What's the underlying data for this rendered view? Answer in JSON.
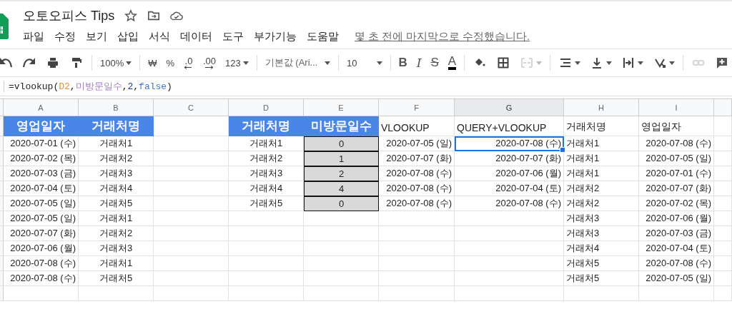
{
  "document": {
    "title": "오토오피스 Tips",
    "starred": false
  },
  "menu": [
    "파일",
    "수정",
    "보기",
    "삽입",
    "서식",
    "데이터",
    "도구",
    "부가기능",
    "도움말"
  ],
  "last_edit": "몇 초 전에 마지막으로 수정했습니다.",
  "toolbar": [
    {
      "kind": "undo",
      "disabled": false,
      "dropdown": false
    },
    {
      "kind": "redo",
      "disabled": false,
      "dropdown": false
    },
    {
      "kind": "print",
      "disabled": false,
      "dropdown": false
    },
    {
      "kind": "paint-format",
      "disabled": false,
      "dropdown": false
    },
    {
      "kind": "separator"
    },
    {
      "kind": "text",
      "text": "100%",
      "disabled": false,
      "dropdown": true
    },
    {
      "kind": "separator"
    },
    {
      "kind": "text",
      "text": "₩",
      "disabled": false,
      "dropdown": false
    },
    {
      "kind": "text",
      "text": "%",
      "disabled": false,
      "dropdown": false
    },
    {
      "kind": "decimal-decrease",
      "text": ".0",
      "disabled": false,
      "dropdown": false
    },
    {
      "kind": "decimal-increase",
      "text": ".00",
      "disabled": false,
      "dropdown": false
    },
    {
      "kind": "text",
      "text": "123",
      "disabled": false,
      "dropdown": true
    },
    {
      "kind": "separator"
    },
    {
      "kind": "font",
      "text": "기본값 (Ari...",
      "disabled": false,
      "dropdown": true
    },
    {
      "kind": "separator"
    },
    {
      "kind": "font-size",
      "text": "10",
      "disabled": false,
      "dropdown": true
    },
    {
      "kind": "separator"
    },
    {
      "kind": "bold",
      "text": "B",
      "disabled": false,
      "dropdown": false
    },
    {
      "kind": "italic",
      "text": "I",
      "disabled": false,
      "dropdown": false
    },
    {
      "kind": "strike",
      "text": "S",
      "disabled": false,
      "dropdown": false
    },
    {
      "kind": "text-color",
      "text": "A",
      "disabled": false,
      "dropdown": false
    },
    {
      "kind": "separator"
    },
    {
      "kind": "fill",
      "disabled": false,
      "dropdown": false
    },
    {
      "kind": "borders",
      "disabled": false,
      "dropdown": false
    },
    {
      "kind": "merge",
      "disabled": true,
      "dropdown": true
    },
    {
      "kind": "separator"
    },
    {
      "kind": "h-align",
      "disabled": false,
      "dropdown": true
    },
    {
      "kind": "v-align",
      "disabled": false,
      "dropdown": true
    },
    {
      "kind": "wrap",
      "disabled": false,
      "dropdown": true
    },
    {
      "kind": "rotate",
      "disabled": false,
      "dropdown": true
    },
    {
      "kind": "separator"
    },
    {
      "kind": "link",
      "disabled": true,
      "dropdown": false
    },
    {
      "kind": "comment",
      "disabled": false,
      "dropdown": false
    }
  ],
  "formula": [
    {
      "kind": "plain",
      "text": "=vlookup("
    },
    {
      "kind": "ref",
      "text": "D2"
    },
    {
      "kind": "plain",
      "text": ","
    },
    {
      "kind": "range",
      "text": "미방문일수"
    },
    {
      "kind": "plain",
      "text": ","
    },
    {
      "kind": "number",
      "text": "2"
    },
    {
      "kind": "plain",
      "text": ","
    },
    {
      "kind": "bool",
      "text": "false"
    },
    {
      "kind": "plain",
      "text": ")"
    }
  ],
  "sheet": {
    "columns": [
      {
        "label": "A",
        "selected": false
      },
      {
        "label": "B",
        "selected": false
      },
      {
        "label": "C",
        "selected": false
      },
      {
        "label": "D",
        "selected": false
      },
      {
        "label": "E",
        "selected": false
      },
      {
        "label": "F",
        "selected": false
      },
      {
        "label": "G",
        "selected": true
      },
      {
        "label": "H",
        "selected": false
      },
      {
        "label": "I",
        "selected": false
      }
    ],
    "rows": [
      {
        "cells": [
          {
            "kind": "header",
            "text": "영업일자",
            "selected": false
          },
          {
            "kind": "header",
            "text": "거래처명",
            "selected": false
          },
          {
            "kind": "empty"
          },
          {
            "kind": "header",
            "text": "거래처명",
            "selected": false
          },
          {
            "kind": "header",
            "text": "미방문일수",
            "selected": false
          },
          {
            "kind": "text",
            "text": "VLOOKUP",
            "selected": false
          },
          {
            "kind": "text",
            "text": "QUERY+VLOOKUP",
            "selected": false
          },
          {
            "kind": "text",
            "text": "거래처명",
            "selected": false
          },
          {
            "kind": "text",
            "text": "영업일자",
            "selected": false
          }
        ]
      },
      {
        "cells": [
          {
            "kind": "date",
            "text": "2020-07-01 (수)",
            "selected": false
          },
          {
            "kind": "centered",
            "text": "거래처1",
            "selected": false
          },
          {
            "kind": "empty"
          },
          {
            "kind": "centered",
            "text": "거래처1",
            "selected": false
          },
          {
            "kind": "boxed",
            "text": "0",
            "selected": false
          },
          {
            "kind": "date",
            "text": "2020-07-05 (일)",
            "selected": false
          },
          {
            "kind": "date",
            "text": "2020-07-08 (수)",
            "selected": true
          },
          {
            "kind": "text",
            "text": "거래처1",
            "selected": false
          },
          {
            "kind": "date",
            "text": "2020-07-08 (수)",
            "selected": false
          }
        ]
      },
      {
        "cells": [
          {
            "kind": "date",
            "text": "2020-07-02 (목)",
            "selected": false
          },
          {
            "kind": "centered",
            "text": "거래처2",
            "selected": false
          },
          {
            "kind": "empty"
          },
          {
            "kind": "centered",
            "text": "거래처2",
            "selected": false
          },
          {
            "kind": "boxed",
            "text": "1",
            "selected": false
          },
          {
            "kind": "date",
            "text": "2020-07-07 (화)",
            "selected": false
          },
          {
            "kind": "date",
            "text": "2020-07-07 (화)",
            "selected": false
          },
          {
            "kind": "text",
            "text": "거래처1",
            "selected": false
          },
          {
            "kind": "date",
            "text": "2020-07-05 (일)",
            "selected": false
          }
        ]
      },
      {
        "cells": [
          {
            "kind": "date",
            "text": "2020-07-03 (금)",
            "selected": false
          },
          {
            "kind": "centered",
            "text": "거래처3",
            "selected": false
          },
          {
            "kind": "empty"
          },
          {
            "kind": "centered",
            "text": "거래처3",
            "selected": false
          },
          {
            "kind": "boxed",
            "text": "2",
            "selected": false
          },
          {
            "kind": "date",
            "text": "2020-07-08 (수)",
            "selected": false
          },
          {
            "kind": "date",
            "text": "2020-07-06 (월)",
            "selected": false
          },
          {
            "kind": "text",
            "text": "거래처1",
            "selected": false
          },
          {
            "kind": "date",
            "text": "2020-07-01 (수)",
            "selected": false
          }
        ]
      },
      {
        "cells": [
          {
            "kind": "date",
            "text": "2020-07-04 (토)",
            "selected": false
          },
          {
            "kind": "centered",
            "text": "거래처4",
            "selected": false
          },
          {
            "kind": "empty"
          },
          {
            "kind": "centered",
            "text": "거래처4",
            "selected": false
          },
          {
            "kind": "boxed",
            "text": "4",
            "selected": false
          },
          {
            "kind": "date",
            "text": "2020-07-08 (수)",
            "selected": false
          },
          {
            "kind": "date",
            "text": "2020-07-04 (토)",
            "selected": false
          },
          {
            "kind": "text",
            "text": "거래처2",
            "selected": false
          },
          {
            "kind": "date",
            "text": "2020-07-07 (화)",
            "selected": false
          }
        ]
      },
      {
        "cells": [
          {
            "kind": "date",
            "text": "2020-07-05 (일)",
            "selected": false
          },
          {
            "kind": "centered",
            "text": "거래처5",
            "selected": false
          },
          {
            "kind": "empty"
          },
          {
            "kind": "centered",
            "text": "거래처5",
            "selected": false
          },
          {
            "kind": "boxed",
            "text": "0",
            "selected": false
          },
          {
            "kind": "date",
            "text": "2020-07-08 (수)",
            "selected": false
          },
          {
            "kind": "date",
            "text": "2020-07-08 (수)",
            "selected": false
          },
          {
            "kind": "text",
            "text": "거래처2",
            "selected": false
          },
          {
            "kind": "date",
            "text": "2020-07-02 (목)",
            "selected": false
          }
        ]
      },
      {
        "cells": [
          {
            "kind": "date",
            "text": "2020-07-05 (일)",
            "selected": false
          },
          {
            "kind": "centered",
            "text": "거래처1",
            "selected": false
          },
          {
            "kind": "empty"
          },
          {
            "kind": "empty"
          },
          {
            "kind": "empty"
          },
          {
            "kind": "empty"
          },
          {
            "kind": "empty"
          },
          {
            "kind": "text",
            "text": "거래처3",
            "selected": false
          },
          {
            "kind": "date",
            "text": "2020-07-06 (월)",
            "selected": false
          }
        ]
      },
      {
        "cells": [
          {
            "kind": "date",
            "text": "2020-07-07 (화)",
            "selected": false
          },
          {
            "kind": "centered",
            "text": "거래처2",
            "selected": false
          },
          {
            "kind": "empty"
          },
          {
            "kind": "empty"
          },
          {
            "kind": "empty"
          },
          {
            "kind": "empty"
          },
          {
            "kind": "empty"
          },
          {
            "kind": "text",
            "text": "거래처3",
            "selected": false
          },
          {
            "kind": "date",
            "text": "2020-07-03 (금)",
            "selected": false
          }
        ]
      },
      {
        "cells": [
          {
            "kind": "date",
            "text": "2020-07-06 (월)",
            "selected": false
          },
          {
            "kind": "centered",
            "text": "거래처3",
            "selected": false
          },
          {
            "kind": "empty"
          },
          {
            "kind": "empty"
          },
          {
            "kind": "empty"
          },
          {
            "kind": "empty"
          },
          {
            "kind": "empty"
          },
          {
            "kind": "text",
            "text": "거래처4",
            "selected": false
          },
          {
            "kind": "date",
            "text": "2020-07-04 (토)",
            "selected": false
          }
        ]
      },
      {
        "cells": [
          {
            "kind": "date",
            "text": "2020-07-08 (수)",
            "selected": false
          },
          {
            "kind": "centered",
            "text": "거래처1",
            "selected": false
          },
          {
            "kind": "empty"
          },
          {
            "kind": "empty"
          },
          {
            "kind": "empty"
          },
          {
            "kind": "empty"
          },
          {
            "kind": "empty"
          },
          {
            "kind": "text",
            "text": "거래처5",
            "selected": false
          },
          {
            "kind": "date",
            "text": "2020-07-08 (수)",
            "selected": false
          }
        ]
      },
      {
        "cells": [
          {
            "kind": "date",
            "text": "2020-07-08 (수)",
            "selected": false
          },
          {
            "kind": "centered",
            "text": "거래처5",
            "selected": false
          },
          {
            "kind": "empty"
          },
          {
            "kind": "empty"
          },
          {
            "kind": "empty"
          },
          {
            "kind": "empty"
          },
          {
            "kind": "empty"
          },
          {
            "kind": "text",
            "text": "거래처5",
            "selected": false
          },
          {
            "kind": "date",
            "text": "2020-07-05 (일)",
            "selected": false
          }
        ]
      }
    ]
  }
}
